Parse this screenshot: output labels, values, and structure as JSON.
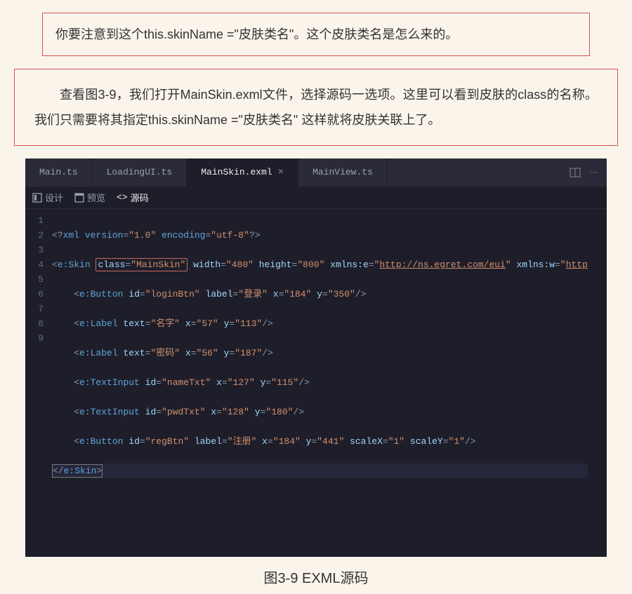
{
  "noteText": "你要注意到这个this.skinName =\"皮肤类名\"。这个皮肤类名是怎么来的。",
  "paraText": "查看图3-9，我们打开MainSkin.exml文件，选择源码一选项。这里可以看到皮肤的class的名称。我们只需要将其指定this.skinName =\"皮肤类名\" 这样就将皮肤关联上了。",
  "editor": {
    "tabs": [
      {
        "label": "Main.ts",
        "active": false
      },
      {
        "label": "LoadingUI.ts",
        "active": false
      },
      {
        "label": "MainSkin.exml",
        "active": true
      },
      {
        "label": "MainView.ts",
        "active": false
      }
    ],
    "viewbar": {
      "design": "设计",
      "preview": "预览",
      "source": "源码"
    },
    "lines": [
      "1",
      "2",
      "3",
      "4",
      "5",
      "6",
      "7",
      "8",
      "9"
    ],
    "code": {
      "l1_a": "<?",
      "l1_b": "xml version",
      "l1_c": "=",
      "l1_d": "\"1.0\"",
      "l1_e": " encoding",
      "l1_f": "=",
      "l1_g": "\"utf-8\"",
      "l1_h": "?>",
      "l2_a": "<",
      "l2_b": "e:Skin",
      "l2_hl_a": "class",
      "l2_hl_b": "=",
      "l2_hl_c": "\"MainSkin\"",
      "l2_d": "width",
      "l2_e": "=",
      "l2_f": "\"480\"",
      "l2_g": " height",
      "l2_h": "=",
      "l2_i": "\"800\"",
      "l2_j": " xmlns:e",
      "l2_k": "=",
      "l2_l": "\"",
      "l2_url1": "http://ns.egret.com/eui",
      "l2_m": "\"",
      "l2_n": " xmlns:w",
      "l2_o": "=",
      "l2_p": "\"",
      "l2_url2": "http",
      "l3": "    <e:Button id=\"loginBtn\" label=\"登录\" x=\"184\" y=\"350\"/>",
      "l4": "    <e:Label text=\"名字\" x=\"57\" y=\"113\"/>",
      "l5": "    <e:Label text=\"密码\" x=\"56\" y=\"187\"/>",
      "l6": "    <e:TextInput id=\"nameTxt\" x=\"127\" y=\"115\"/>",
      "l7": "    <e:TextInput id=\"pwdTxt\" x=\"128\" y=\"180\"/>",
      "l8": "    <e:Button id=\"regBtn\" label=\"注册\" x=\"184\" y=\"441\" scaleX=\"1\" scaleY=\"1\"/>",
      "l9_a": "<",
      "l9_b": "/",
      "l9_c": "e:Skin",
      "l9_d": ">"
    }
  },
  "caption": "图3-9 EXML源码"
}
